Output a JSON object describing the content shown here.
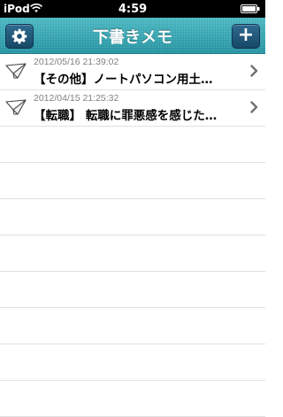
{
  "status_bar": {
    "carrier": "iPod",
    "time": "4:59"
  },
  "nav": {
    "title": "下書きメモ",
    "left_icon": "gear-icon",
    "right_label": "+"
  },
  "memos": [
    {
      "date": "2012/05/16 21:39:02",
      "title": "【その他】ノートパソコン用土…"
    },
    {
      "date": "2012/04/15 21:25:32",
      "title": "【転職】 転職に罪悪感を感じた…"
    }
  ],
  "colors": {
    "nav_top": "#4fbcc6",
    "nav_bottom": "#2a98a6",
    "button": "#174866"
  }
}
